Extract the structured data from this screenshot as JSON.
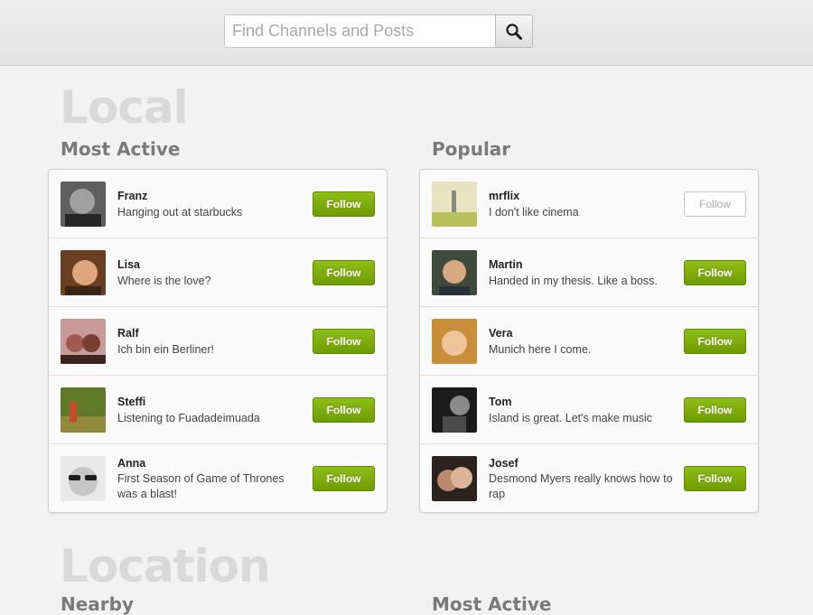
{
  "search": {
    "placeholder": "Find Channels and Posts"
  },
  "colors": {
    "accent_green": "#7aa80a",
    "section_heading": "#d9d9d9"
  },
  "icons": {
    "search_button": "search-icon"
  },
  "local": {
    "title": "Local",
    "most_active": {
      "title": "Most Active",
      "items": [
        {
          "name": "Franz",
          "status": "Hanging out at starbucks",
          "button": "Follow",
          "following": false
        },
        {
          "name": "Lisa",
          "status": "Where is the love?",
          "button": "Follow",
          "following": false
        },
        {
          "name": "Ralf",
          "status": "Ich bin ein Berliner!",
          "button": "Follow",
          "following": false
        },
        {
          "name": "Steffi",
          "status": "Listening to Fuadadeimuada",
          "button": "Follow",
          "following": false
        },
        {
          "name": "Anna",
          "status": "First Season of Game of Thrones was a blast!",
          "button": "Follow",
          "following": false
        }
      ]
    },
    "popular": {
      "title": "Popular",
      "items": [
        {
          "name": "mrflix",
          "status": "I don't like cinema",
          "button": "Follow",
          "following": true
        },
        {
          "name": "Martin",
          "status": "Handed in my thesis. Like a boss.",
          "button": "Follow",
          "following": false
        },
        {
          "name": "Vera",
          "status": "Munich here I come.",
          "button": "Follow",
          "following": false
        },
        {
          "name": "Tom",
          "status": "Island is great. Let's make music",
          "button": "Follow",
          "following": false
        },
        {
          "name": "Josef",
          "status": "Desmond Myers really knows how to rap",
          "button": "Follow",
          "following": false
        }
      ]
    }
  },
  "location": {
    "title": "Location",
    "nearby": {
      "title": "Nearby"
    },
    "most_active": {
      "title": "Most Active"
    }
  }
}
